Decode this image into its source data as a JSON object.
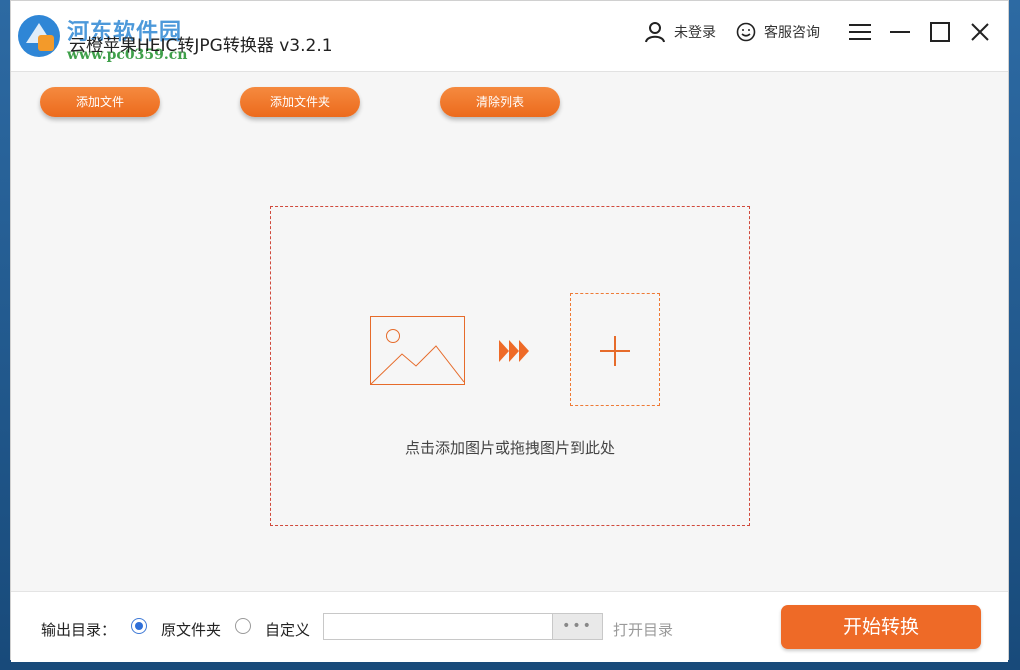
{
  "window": {
    "title": "云橙苹果HEIC转JPG转换器 v3.2.1",
    "watermark_text": "河东软件园",
    "watermark_url": "www.pc0359.cn",
    "login_label": "未登录",
    "support_label": "客服咨询"
  },
  "toolbar": {
    "add_file": "添加文件",
    "add_folder": "添加文件夹",
    "clear_list": "清除列表"
  },
  "dropzone": {
    "hint": "点击添加图片或拖拽图片到此处"
  },
  "output": {
    "label": "输出目录：",
    "option_original": "原文件夹",
    "option_custom": "自定义",
    "selected": "原文件夹",
    "path_value": "",
    "browse_label": "•••",
    "open_dir": "打开目录",
    "start_button": "开始转换"
  },
  "colors": {
    "accent": "#ee6a27",
    "dashed_border": "#d04a3c",
    "radio_selected": "#2f6fd8"
  }
}
